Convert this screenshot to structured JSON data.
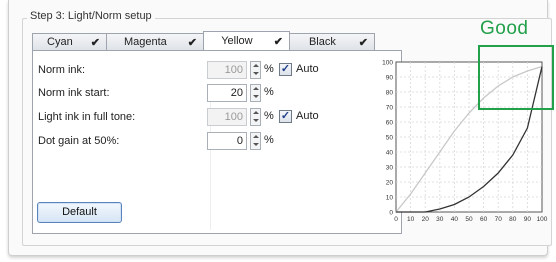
{
  "group": {
    "title": "Step 3: Light/Norm setup"
  },
  "tabs": [
    {
      "label": "Cyan",
      "check": "✔"
    },
    {
      "label": "Magenta",
      "check": "✔"
    },
    {
      "label": "Yellow",
      "check": "✔"
    },
    {
      "label": "Black",
      "check": "✔"
    }
  ],
  "fields": {
    "norm_ink": {
      "label": "Norm ink:",
      "value": "100",
      "unit": "%",
      "auto_label": "Auto",
      "auto_checked": "✓"
    },
    "norm_ink_start": {
      "label": "Norm ink start:",
      "value": "20",
      "unit": "%"
    },
    "light_ink_full_tone": {
      "label": "Light ink in full tone:",
      "value": "100",
      "unit": "%",
      "auto_label": "Auto",
      "auto_checked": "✓"
    },
    "dot_gain": {
      "label": "Dot gain at 50%:",
      "value": "0",
      "unit": "%"
    }
  },
  "buttons": {
    "default_label": "Default"
  },
  "annotation": {
    "text": "Good",
    "color": "#22a04a"
  },
  "chart_data": {
    "type": "line",
    "xlim": [
      0,
      100
    ],
    "ylim": [
      0,
      100
    ],
    "x_ticks": [
      0,
      10,
      20,
      30,
      40,
      50,
      60,
      70,
      80,
      90,
      100
    ],
    "y_ticks": [
      0,
      10,
      20,
      30,
      40,
      50,
      60,
      70,
      80,
      90,
      100
    ],
    "grid": true,
    "series": [
      {
        "color": "#c8c8c8",
        "x": [
          0,
          10,
          20,
          30,
          40,
          50,
          60,
          70,
          80,
          90,
          100
        ],
        "y": [
          0,
          12,
          26,
          40,
          54,
          66,
          76,
          84,
          90,
          94,
          97
        ]
      },
      {
        "color": "#333333",
        "x": [
          0,
          20,
          30,
          40,
          50,
          60,
          70,
          80,
          90,
          100
        ],
        "y": [
          0,
          0,
          2,
          5,
          10,
          17,
          26,
          38,
          56,
          97
        ]
      }
    ]
  }
}
